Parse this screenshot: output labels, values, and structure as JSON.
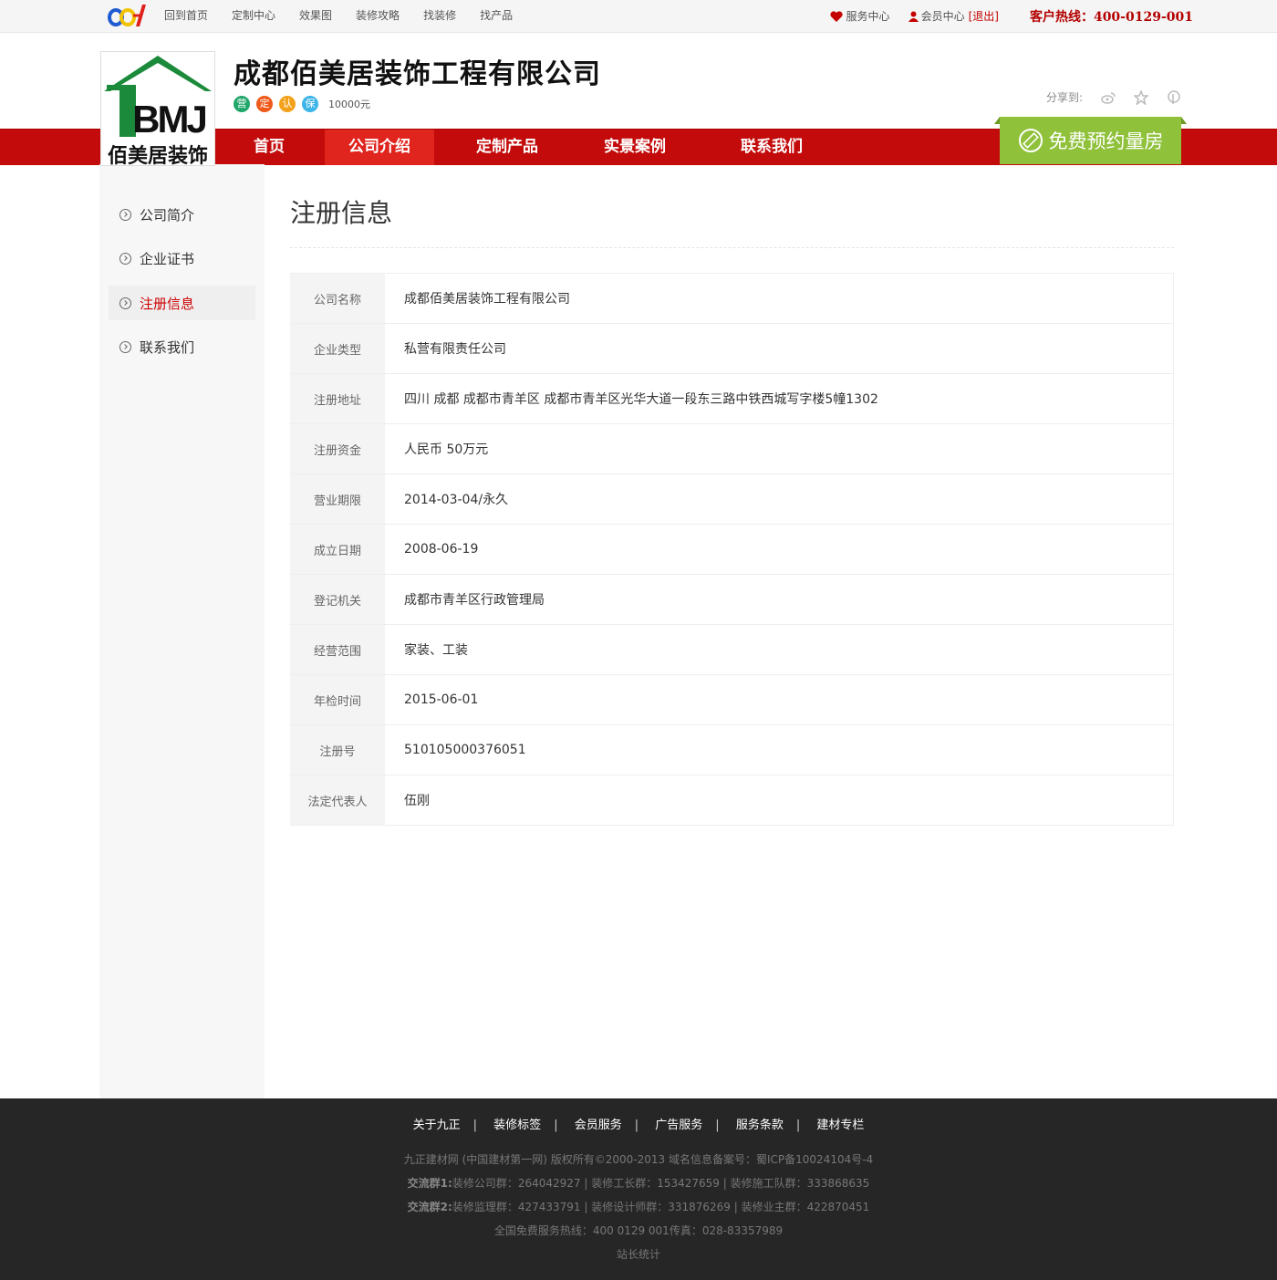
{
  "topbar": {
    "nav": [
      "回到首页",
      "定制中心",
      "效果图",
      "装修攻略",
      "找装修",
      "找产品"
    ],
    "service": "服务中心",
    "member": "会员中心",
    "logout": "[退出]",
    "hotline": "客户热线：400-0129-001"
  },
  "header": {
    "logo_text": "佰美居装饰",
    "logo_mark": "BMJ",
    "company": "成都佰美居装饰工程有限公司",
    "badges": [
      {
        "label": "营",
        "color": "#21a66b"
      },
      {
        "label": "定",
        "color": "#f05a1a"
      },
      {
        "label": "认",
        "color": "#f3a11a"
      },
      {
        "label": "保",
        "color": "#3db5e8"
      }
    ],
    "deposit": "10000元",
    "share_label": "分享到:"
  },
  "nav": {
    "items": [
      "首页",
      "公司介绍",
      "定制产品",
      "实景案例",
      "联系我们"
    ],
    "active": "公司介绍",
    "free_button": "免费预约量房"
  },
  "sidebar": {
    "items": [
      "公司简介",
      "企业证书",
      "注册信息",
      "联系我们"
    ],
    "active": "注册信息"
  },
  "main": {
    "title": "注册信息",
    "rows": [
      {
        "key": "公司名称",
        "value": "成都佰美居装饰工程有限公司"
      },
      {
        "key": "企业类型",
        "value": "私营有限责任公司"
      },
      {
        "key": "注册地址",
        "value": "四川 成都 成都市青羊区 成都市青羊区光华大道一段东三路中铁西城写字楼5幢1302"
      },
      {
        "key": "注册资金",
        "value": "人民币 50万元"
      },
      {
        "key": "营业期限",
        "value": "2014-03-04/永久"
      },
      {
        "key": "成立日期",
        "value": "2008-06-19"
      },
      {
        "key": "登记机关",
        "value": "成都市青羊区行政管理局"
      },
      {
        "key": "经营范围",
        "value": "家装、工装"
      },
      {
        "key": "年检时间",
        "value": "2015-06-01"
      },
      {
        "key": "注册号",
        "value": "510105000376051"
      },
      {
        "key": "法定代表人",
        "value": "伍刚"
      }
    ]
  },
  "footer": {
    "links": [
      "关于九正",
      "装修标签",
      "会员服务",
      "广告服务",
      "服务条款",
      "建材专栏"
    ],
    "separator": "|",
    "copyright": "九正建材网 (中国建材第一网) 版权所有©2000-2013   域名信息备案号：蜀ICP备10024104号-4",
    "group1_label": "交流群1:",
    "group1": "装修公司群：264042927 | 装修工长群：153427659 | 装修施工队群：333868635",
    "group2_label": "交流群2:",
    "group2": "装修监理群：427433791 | 装修设计师群：331876269 | 装修业主群：422870451",
    "hotline": "全国免费服务热线：400 0129 001传真：028-83357989",
    "stats": "站长统计"
  }
}
